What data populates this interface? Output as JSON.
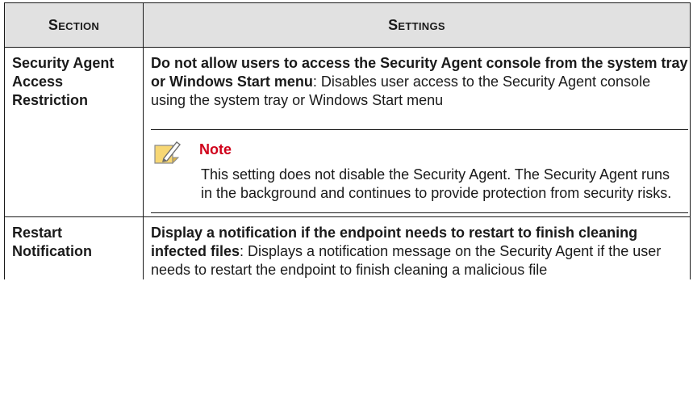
{
  "table": {
    "headers": {
      "section": "Section",
      "settings": "Settings"
    },
    "rows": [
      {
        "section": "Security Agent Access Restriction",
        "setting_bold": "Do not allow users to access the Security Agent console from the system tray or Windows Start menu",
        "setting_text": ": Disables user access to the Security Agent console using the system tray or Windows Start menu",
        "note": {
          "icon": "note-pencil-icon",
          "title": "Note",
          "body": "This setting does not disable the Security Agent. The Security Agent runs in the background and continues to provide protection from security risks."
        }
      },
      {
        "section": "Restart Notification",
        "setting_bold": "Display a notification if the endpoint needs to restart to finish cleaning infected files",
        "setting_text": ": Displays a notification message on the Security Agent if the user needs to restart the endpoint to finish cleaning a malicious file"
      }
    ]
  },
  "colors": {
    "header_bg": "#e1e1e1",
    "note_title": "#d0021b",
    "note_icon_fill": "#f7d774"
  }
}
